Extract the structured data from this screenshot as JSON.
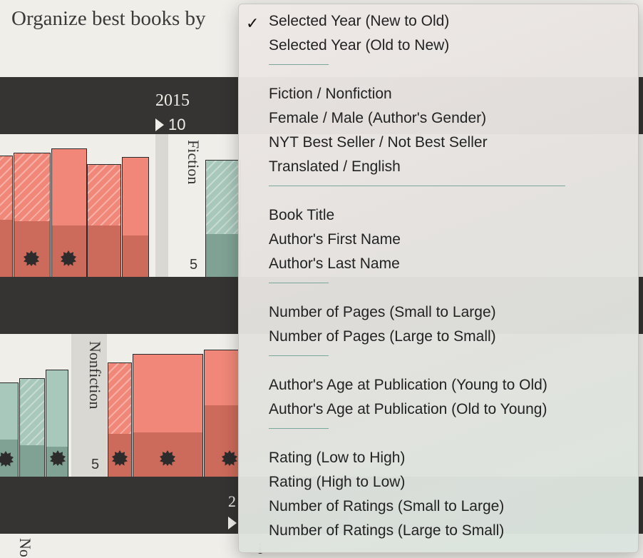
{
  "header": {
    "title": "Organize best books by"
  },
  "year_group": {
    "year": "2015",
    "count": "10"
  },
  "shelves": {
    "fiction": {
      "label": "Fiction",
      "count": "5"
    },
    "nonfiction": {
      "label": "Nonfiction",
      "count": "5"
    }
  },
  "next_group": {
    "year_partial": "2"
  },
  "bottom_fragments": {
    "left": "No",
    "mid": "i"
  },
  "sort_menu": {
    "selected": "Selected Year (New to Old)",
    "checkmark": "✓",
    "groups": [
      [
        "Selected Year (New to Old)",
        "Selected Year (Old to New)"
      ],
      [
        "Fiction / Nonfiction",
        "Female / Male (Author's Gender)",
        "NYT Best Seller / Not Best Seller",
        "Translated / English"
      ],
      [
        "Book Title",
        "Author's First Name",
        "Author's Last Name"
      ],
      [
        "Number of Pages (Small to Large)",
        "Number of Pages (Large to Small)"
      ],
      [
        "Author's Age at Publication (Young to Old)",
        "Author's Age at Publication (Old to Young)"
      ],
      [
        "Rating (Low to High)",
        "Rating (High to Low)",
        "Number of Ratings (Small to Large)",
        "Number of Ratings (Large to Small)"
      ]
    ]
  },
  "colors": {
    "fiction_red": "#f08778",
    "nonfiction_green": "#a9c8bc",
    "shelf_band": "#353432",
    "menu_separator": "#7aa79b"
  },
  "icons": {
    "best_seller_badge": "starburst-icon",
    "count_marker": "triangle-right-icon"
  }
}
